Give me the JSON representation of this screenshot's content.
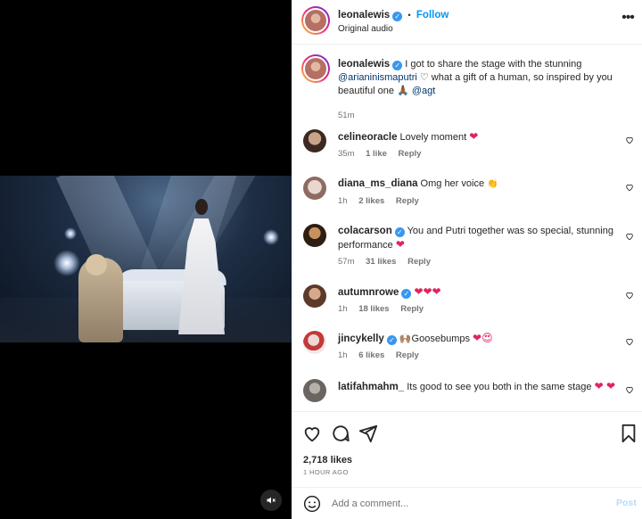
{
  "header": {
    "username": "leonalewis",
    "separator": "•",
    "follow_label": "Follow",
    "audio_label": "Original audio",
    "more_label": "•••"
  },
  "caption": {
    "username": "leonalewis",
    "text_part1": "I got to share the stage with the stunning",
    "mention1": "@arianinismaputri",
    "text_part2": "♡ what a gift of a human, so inspired by you beautiful one 🙏🏾",
    "mention2": "@agt",
    "time": "51m"
  },
  "comments": [
    {
      "username": "celineoracle",
      "verified": false,
      "text": "Lovely moment",
      "emoji": "❤",
      "time": "35m",
      "likes": "1 like",
      "reply": "Reply"
    },
    {
      "username": "diana_ms_diana",
      "verified": false,
      "text": "Omg her voice",
      "emoji": "👏",
      "time": "1h",
      "likes": "2 likes",
      "reply": "Reply"
    },
    {
      "username": "colacarson",
      "verified": true,
      "text": "You and Putri together was so special, stunning performance",
      "emoji": "❤",
      "time": "57m",
      "likes": "31 likes",
      "reply": "Reply"
    },
    {
      "username": "autumnrowe",
      "verified": true,
      "text": "",
      "emoji": "❤❤❤",
      "time": "1h",
      "likes": "18 likes",
      "reply": "Reply"
    },
    {
      "username": "jincykelly",
      "verified": true,
      "text": "🙌🏽Goosebumps",
      "emoji": "❤😍",
      "time": "1h",
      "likes": "6 likes",
      "reply": "Reply"
    },
    {
      "username": "latifahmahm_",
      "verified": false,
      "text": "Its good to see you both in the same stage",
      "emoji": "❤ ❤",
      "time": "",
      "likes": "",
      "reply": ""
    }
  ],
  "footer": {
    "likes": "2,718 likes",
    "ago": "1 HOUR AGO",
    "comment_placeholder": "Add a comment...",
    "post_label": "Post"
  },
  "icons": {
    "header_more": "more-options-icon",
    "like": "heart-icon",
    "comment": "comment-icon",
    "share": "share-icon",
    "save": "bookmark-icon",
    "emoji": "smiley-icon",
    "mute": "muted-speaker-icon"
  },
  "colors": {
    "accent": "#0095f6",
    "verified": "#3897f0",
    "heart_red": "#e0245e",
    "post_disabled": "#b3dbff"
  }
}
